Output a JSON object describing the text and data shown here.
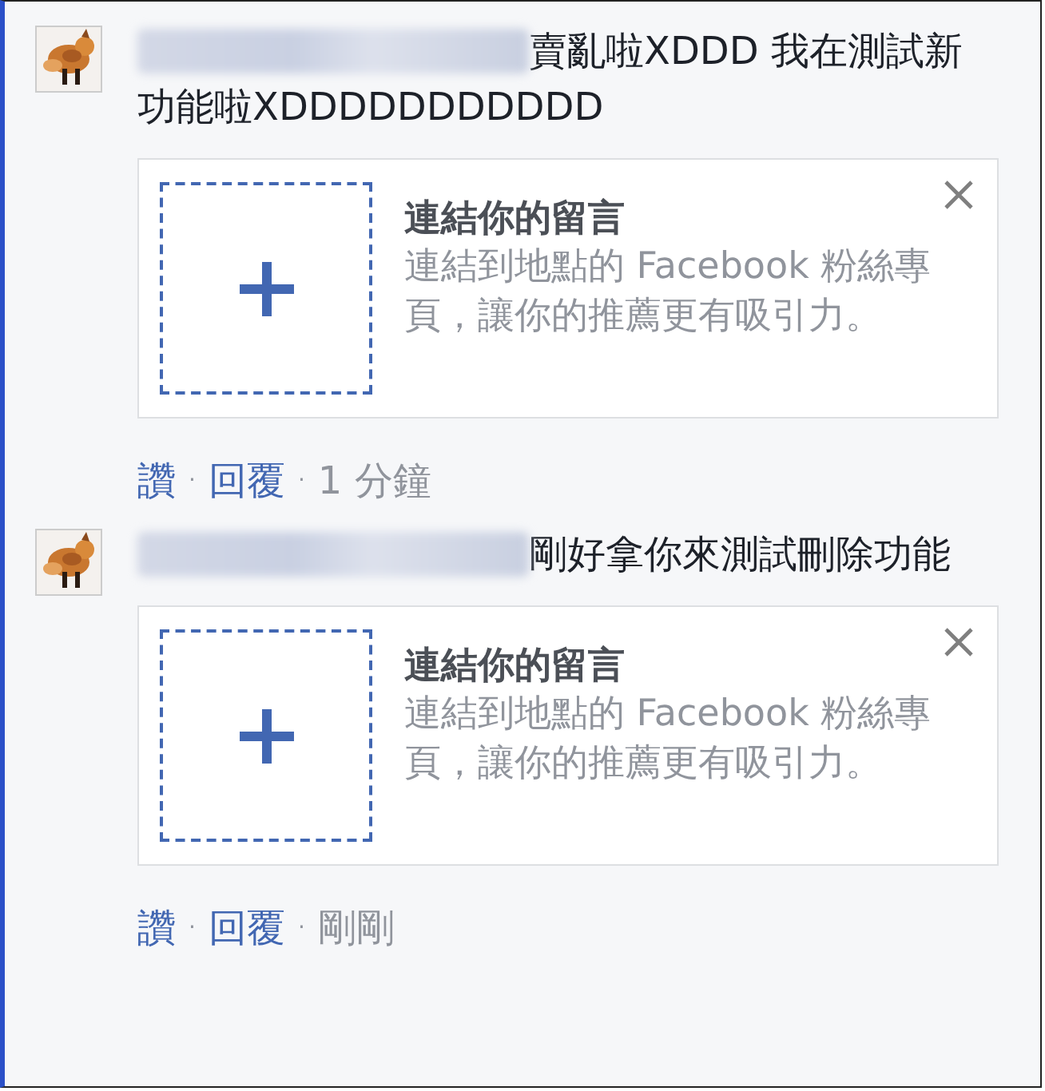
{
  "comments": [
    {
      "name_blurred": true,
      "text": "賣亂啦XDDD 我在測試新功能啦XDDDDDDDDDDD",
      "suggestion": {
        "title": "連結你的留言",
        "description": "連結到地點的 Facebook 粉絲專頁，讓你的推薦更有吸引力。"
      },
      "actions": [
        {
          "kind": "link",
          "text": "讚"
        },
        {
          "kind": "separator",
          "text": "·"
        },
        {
          "kind": "link",
          "text": "回覆"
        },
        {
          "kind": "separator",
          "text": "·"
        },
        {
          "kind": "time",
          "text": "1 分鐘"
        }
      ]
    },
    {
      "name_blurred": true,
      "text": "剛好拿你來測試刪除功能",
      "suggestion": {
        "title": "連結你的留言",
        "description": "連結到地點的 Facebook 粉絲專頁，讓你的推薦更有吸引力。"
      },
      "actions": [
        {
          "kind": "link",
          "text": "讚"
        },
        {
          "kind": "separator",
          "text": "·"
        },
        {
          "kind": "link",
          "text": "回覆"
        },
        {
          "kind": "separator",
          "text": "·"
        },
        {
          "kind": "time",
          "text": "剛剛"
        }
      ]
    }
  ]
}
